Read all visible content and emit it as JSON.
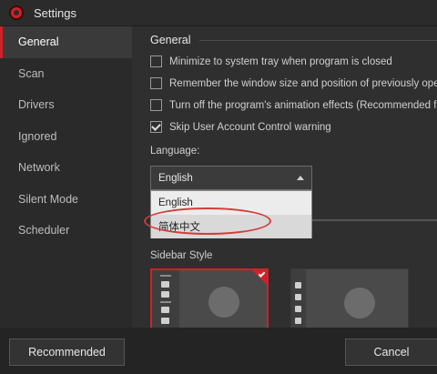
{
  "window": {
    "title": "Settings"
  },
  "sidebar": {
    "items": [
      {
        "label": "General"
      },
      {
        "label": "Scan"
      },
      {
        "label": "Drivers"
      },
      {
        "label": "Ignored"
      },
      {
        "label": "Network"
      },
      {
        "label": "Silent Mode"
      },
      {
        "label": "Scheduler"
      }
    ],
    "active": "General"
  },
  "general": {
    "title": "General",
    "options": [
      {
        "label": "Minimize to system tray when program is closed",
        "checked": false
      },
      {
        "label": "Remember the window size and position of previously opened",
        "checked": false
      },
      {
        "label": "Turn off the program's animation effects (Recommended for",
        "checked": false
      },
      {
        "label": "Skip User Account Control warning",
        "checked": true
      }
    ]
  },
  "language": {
    "label": "Language:",
    "selected": "English",
    "options": [
      "English",
      "简体中文"
    ]
  },
  "sidebar_style": {
    "label": "Sidebar Style",
    "selected_index": 0
  },
  "footer": {
    "recommended_label": "Recommended",
    "cancel_label": "Cancel"
  },
  "colors": {
    "accent": "#d22027",
    "annotation": "#d43b3b"
  }
}
